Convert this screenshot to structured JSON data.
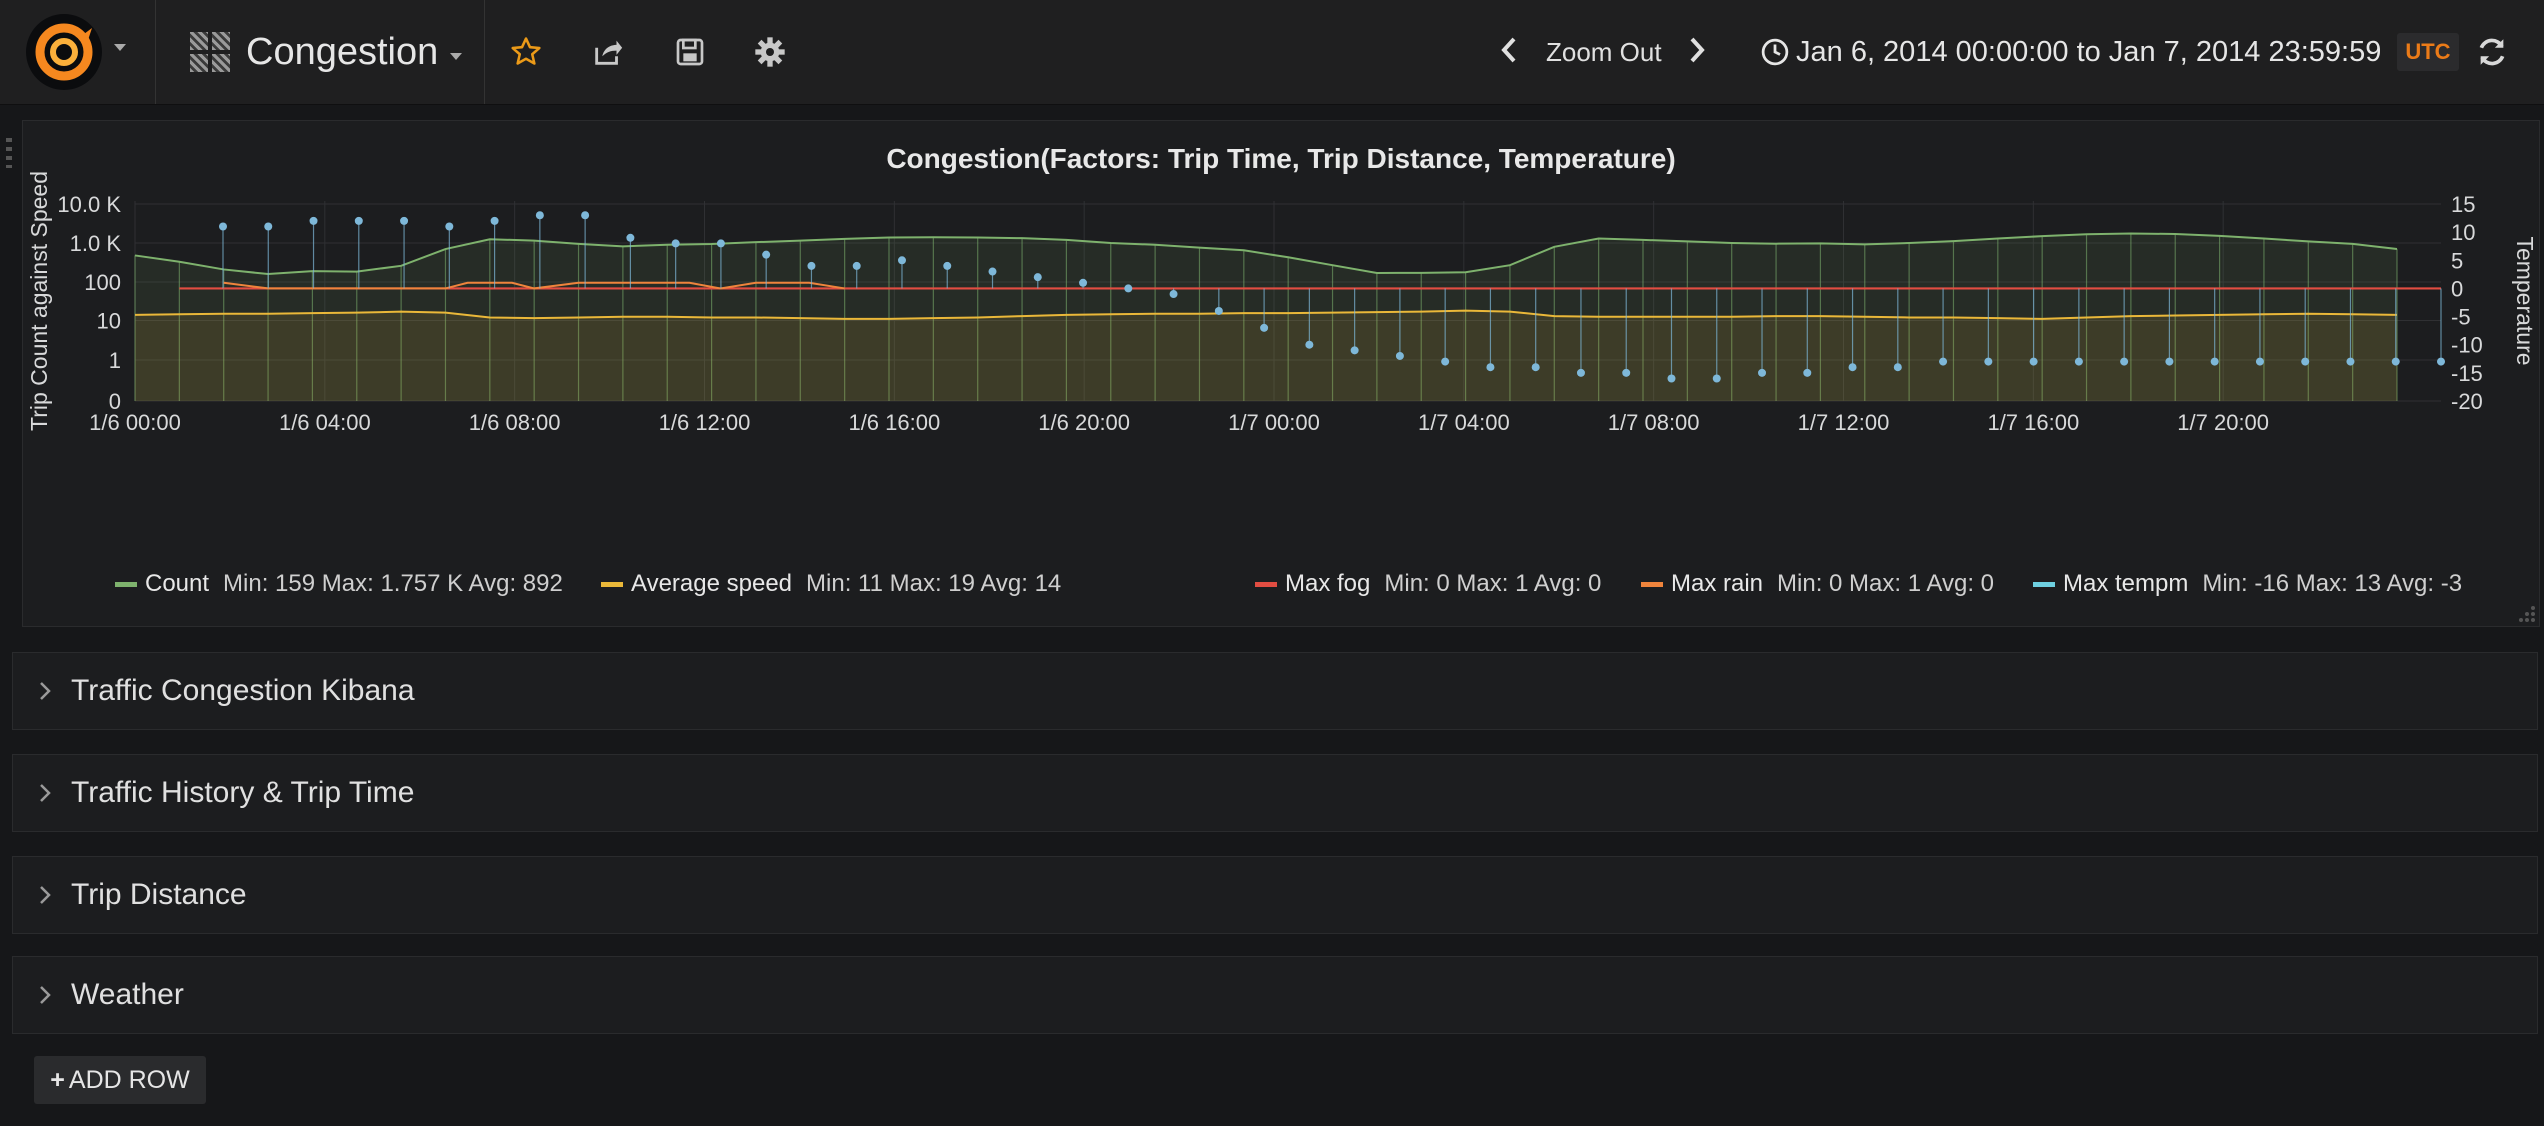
{
  "navbar": {
    "dashboard_title": "Congestion",
    "zoom_out_label": "Zoom Out",
    "time_range_label": "Jan 6, 2014 00:00:00 to Jan 7, 2014 23:59:59",
    "timezone_badge": "UTC"
  },
  "rows": [
    {
      "label": "Traffic Congestion Kibana"
    },
    {
      "label": "Traffic History & Trip Time"
    },
    {
      "label": "Trip Distance"
    },
    {
      "label": "Weather"
    }
  ],
  "add_row_label": "ADD ROW",
  "colors": {
    "count": "#7eb26d",
    "average_speed": "#eab839",
    "max_fog": "#e24d42",
    "max_rain": "#ef843c",
    "max_tempm": "#6ed0e0"
  },
  "chart_data": {
    "type": "line",
    "title": "Congestion(Factors: Trip Time, Trip Distance, Temperature)",
    "ylabel": "Trip Count against Speed",
    "y2label": "Temperature",
    "yscale": "log",
    "y_ticks": [
      "0",
      "1",
      "10",
      "100",
      "1.0 K",
      "10.0 K"
    ],
    "y2_ticks": [
      "15",
      "10",
      "5",
      "0",
      "-5",
      "-10",
      "-15",
      "-20"
    ],
    "y2lim": [
      -20,
      15
    ],
    "x_ticks": [
      "1/6 00:00",
      "1/6 04:00",
      "1/6 08:00",
      "1/6 12:00",
      "1/6 16:00",
      "1/6 20:00",
      "1/7 00:00",
      "1/7 04:00",
      "1/7 08:00",
      "1/7 12:00",
      "1/7 16:00",
      "1/7 20:00"
    ],
    "x_hours": [
      0,
      1,
      2,
      3,
      4,
      5,
      6,
      7,
      8,
      9,
      10,
      11,
      12,
      13,
      14,
      15,
      16,
      17,
      18,
      19,
      20,
      21,
      22,
      23,
      24,
      25,
      26,
      27,
      28,
      29,
      30,
      31,
      32,
      33,
      34,
      35,
      36,
      37,
      38,
      39,
      40,
      41,
      42,
      43,
      44,
      45,
      46,
      47
    ],
    "grid": true,
    "legend_position": "bottom",
    "series": [
      {
        "name": "Count",
        "axis": "left",
        "stats": "Min: 159  Max: 1.757 K  Avg: 892",
        "values": [
          480,
          330,
          210,
          160,
          190,
          185,
          260,
          700,
          1250,
          1150,
          950,
          820,
          900,
          940,
          1050,
          1150,
          1280,
          1380,
          1400,
          1380,
          1330,
          1200,
          1000,
          900,
          760,
          650,
          430,
          270,
          170,
          172,
          178,
          270,
          800,
          1300,
          1200,
          1100,
          1000,
          960,
          980,
          920,
          1000,
          1120,
          1300,
          1500,
          1680,
          1757,
          1700,
          1520,
          1300,
          1100,
          950,
          700
        ]
      },
      {
        "name": "Average speed",
        "axis": "left",
        "stats": "Min: 11  Max: 19  Avg: 14",
        "values": [
          14,
          14.5,
          15,
          15,
          15.5,
          16,
          17,
          16,
          12,
          11.5,
          12,
          12.5,
          12.5,
          12,
          12,
          11.5,
          11,
          11,
          11.5,
          12,
          13,
          14,
          14.5,
          15,
          15,
          15.5,
          15.5,
          16,
          16.5,
          17,
          18,
          17,
          13,
          12.5,
          12.5,
          12.5,
          12.5,
          13,
          13,
          12.5,
          12,
          12,
          11.5,
          11,
          12,
          13,
          13.5,
          14,
          14.5,
          15,
          14.5,
          14
        ]
      },
      {
        "name": "Max fog",
        "axis": "right",
        "stats": "Min: 0  Max: 1  Avg: 0",
        "values": [
          1,
          0,
          0,
          0,
          0,
          0,
          1,
          1,
          0,
          1,
          1,
          1,
          0,
          1,
          1,
          0,
          0,
          0,
          0,
          0,
          0,
          0,
          0,
          0,
          0,
          0,
          0,
          0,
          0,
          0,
          0,
          0,
          0,
          0,
          0,
          0,
          0,
          0,
          0,
          0,
          0,
          0,
          0,
          0,
          0,
          0,
          0,
          0,
          0,
          0,
          0,
          0
        ]
      },
      {
        "name": "Max rain",
        "axis": "right",
        "stats": "Min: 0  Max: 1  Avg: 0",
        "values": [
          1,
          0,
          0,
          0,
          0,
          0,
          1,
          1,
          0,
          1,
          1,
          1,
          0,
          1,
          1,
          0,
          0,
          0,
          0,
          0,
          0,
          0,
          0,
          0,
          0,
          0,
          0,
          0,
          0,
          0,
          0,
          0,
          0,
          0,
          0,
          0,
          0,
          0,
          0,
          0,
          0,
          0,
          0,
          0,
          0,
          0,
          0,
          0,
          0,
          0,
          0,
          0
        ]
      },
      {
        "name": "Max tempm",
        "axis": "right",
        "stats": "Min: -16  Max: 13  Avg: -3",
        "values": [
          11,
          11,
          12,
          12,
          12,
          11,
          12,
          13,
          13,
          9,
          8,
          8,
          6,
          4,
          4,
          5,
          4,
          3,
          2,
          1,
          0,
          -1,
          -4,
          -7,
          -10,
          -11,
          -12,
          -13,
          -14,
          -14,
          -15,
          -15,
          -16,
          -16,
          -15,
          -15,
          -14,
          -14,
          -13,
          -13,
          -13,
          -13,
          -13,
          -13,
          -13,
          -13,
          -13,
          -13,
          -13,
          -13
        ]
      }
    ]
  }
}
